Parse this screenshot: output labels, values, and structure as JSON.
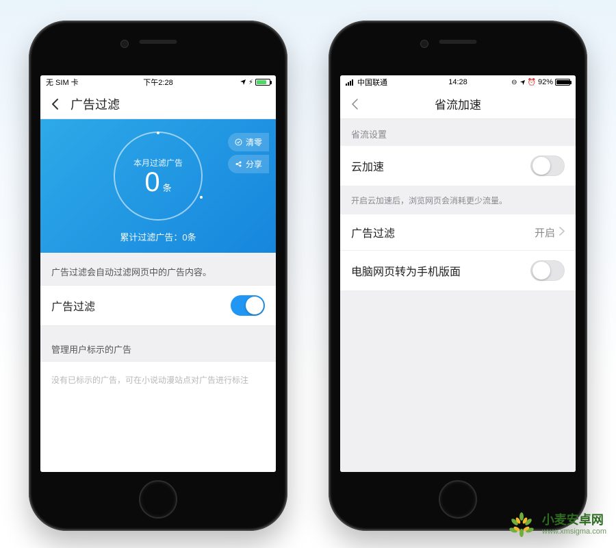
{
  "left": {
    "status": {
      "carrier": "无 SIM 卡",
      "time": "下午2:28"
    },
    "nav": {
      "title": "广告过滤"
    },
    "panel": {
      "clearLabel": "清零",
      "shareLabel": "分享",
      "caption": "本月过滤广告",
      "count": "0",
      "unit": "条",
      "total": "累计过滤广告：0条"
    },
    "desc": "广告过滤会自动过滤网页中的广告内容。",
    "toggleLabel": "广告过滤",
    "subHeader": "管理用户标示的广告",
    "emptyNote": "没有已标示的广告，可在小说动漫站点对广告进行标注"
  },
  "right": {
    "status": {
      "carrier": "中国联通",
      "time": "14:28",
      "battery": "92%"
    },
    "nav": {
      "title": "省流加速"
    },
    "sectionHeader": "省流设置",
    "rows": {
      "cloud": {
        "label": "云加速"
      },
      "hint": "开启云加速后，浏览网页会消耗更少流量。",
      "adfilter": {
        "label": "广告过滤",
        "value": "开启"
      },
      "desktop2mobile": {
        "label": "电脑网页转为手机版面"
      }
    }
  },
  "watermark": {
    "brand": "小麦安卓网",
    "url": "www.xmsigma.com"
  }
}
